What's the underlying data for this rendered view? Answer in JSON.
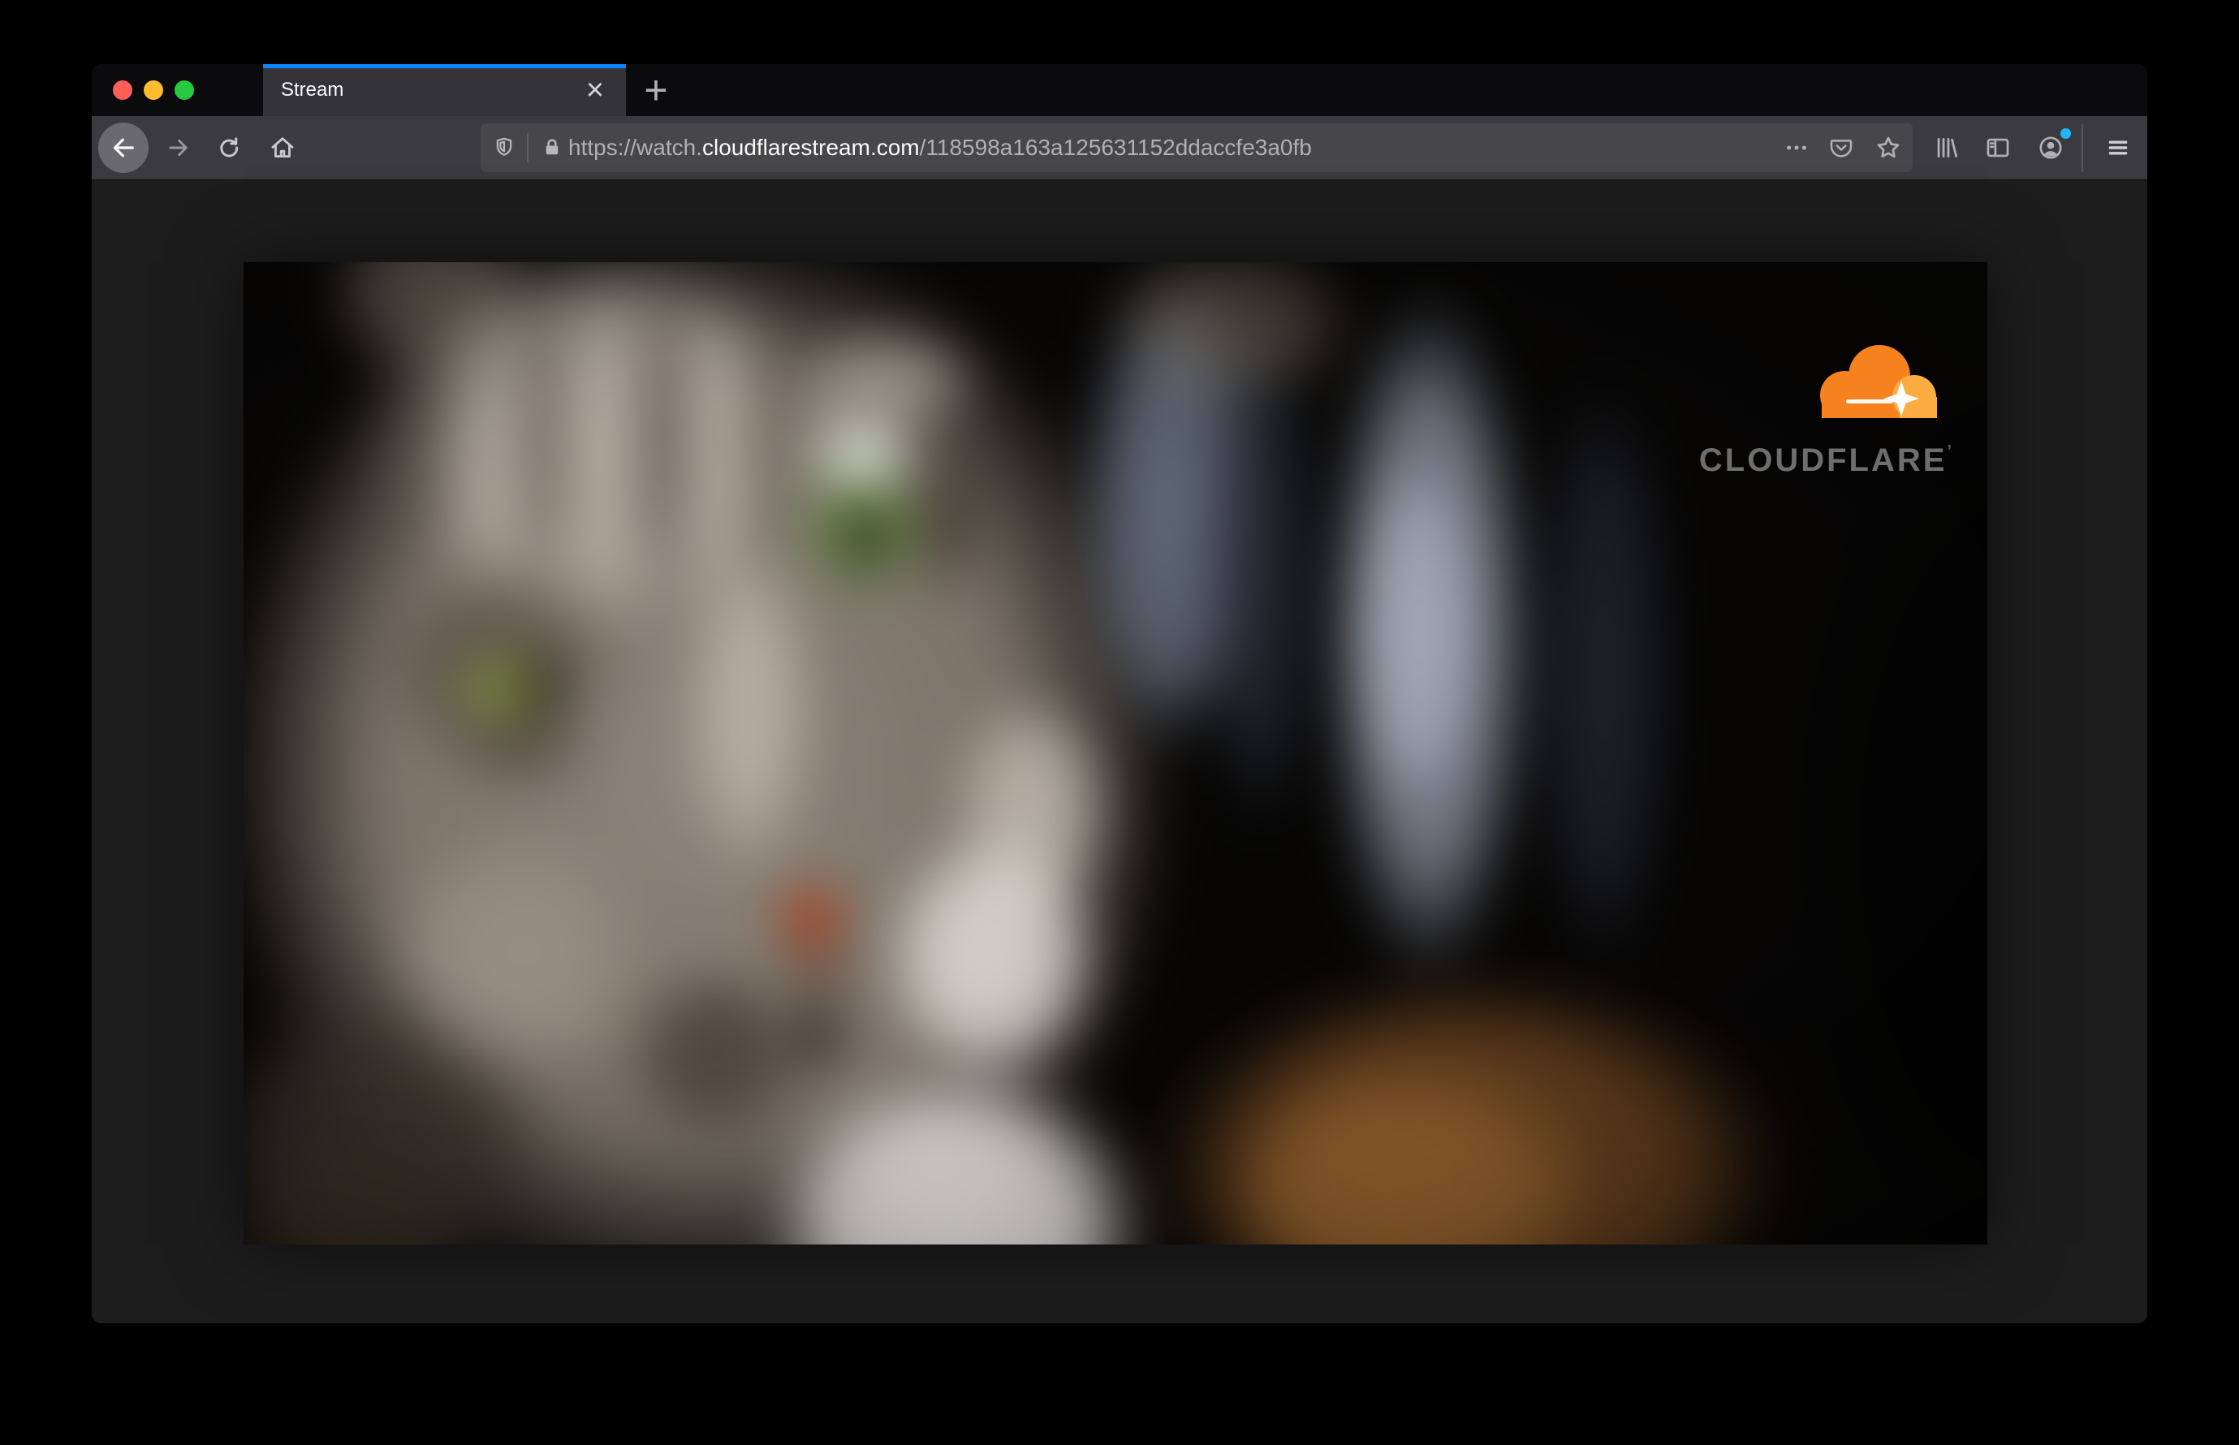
{
  "tabbar": {
    "tab_title": "Stream",
    "close_glyph": "×",
    "new_tab_glyph": "+"
  },
  "urlbar": {
    "prefix": "https://watch.",
    "domain": "cloudflarestream.com",
    "path": "/118598a163a125631152ddaccfe3a0fb"
  },
  "video": {
    "brand": "CLOUDFLARE",
    "brand_tm": "’"
  },
  "colors": {
    "active_tab_accent": "#0a84ff",
    "cloud_orange": "#f6821f",
    "cloud_light_orange": "#fbad41",
    "notification_dot_blue": "#1fb6ff",
    "traffic_close": "#ff5f57",
    "traffic_minimize": "#febc2e",
    "traffic_zoom": "#28c840"
  }
}
